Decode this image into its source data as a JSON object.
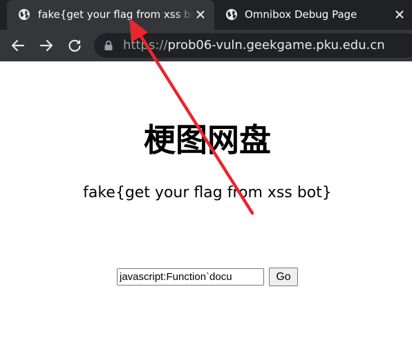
{
  "browser": {
    "tabs": [
      {
        "title": "fake{get your flag from xss bot}",
        "icon": "globe-icon",
        "active": true,
        "close_icon": "close-icon"
      },
      {
        "title": "Omnibox Debug Page",
        "icon": "globe-icon",
        "active": false,
        "close_icon": "close-icon"
      }
    ],
    "toolbar": {
      "back_icon": "back-arrow-icon",
      "forward_icon": "forward-arrow-icon",
      "reload_icon": "reload-icon"
    },
    "address_bar": {
      "lock_icon": "lock-icon",
      "scheme": "https://",
      "host": "prob06-vuln.geekgame.pku.edu.cn"
    }
  },
  "page": {
    "title": "梗图网盘",
    "subtitle": "fake{get your flag from xss bot}",
    "form": {
      "input_value": "javascript:Function`docu",
      "button_label": "Go"
    }
  },
  "annotation": {
    "type": "red arrow",
    "color": "#e8262d"
  },
  "colors": {
    "tabstrip_bg": "#202124",
    "active_tab_bg": "#35363a",
    "omnibox_bg": "#202124",
    "text_light": "#e8eaed"
  }
}
